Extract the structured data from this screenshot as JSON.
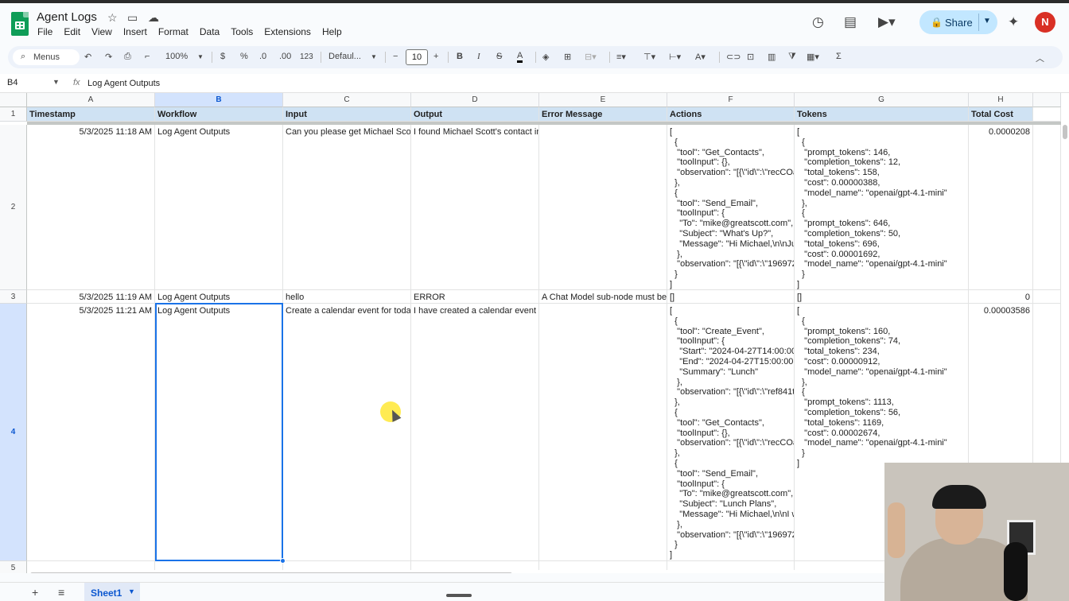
{
  "app": {
    "doc_title": "Agent Logs",
    "menu": [
      "File",
      "Edit",
      "View",
      "Insert",
      "Format",
      "Data",
      "Tools",
      "Extensions",
      "Help"
    ],
    "share_label": "Share",
    "avatar_initial": "N",
    "colors": {
      "accent": "#1a73e8",
      "share_bg": "#c2e7ff",
      "header_fill": "#cfe2f3",
      "avatar": "#d93025",
      "sheets_green": "#0f9d58"
    }
  },
  "toolbar": {
    "menus_label": "Menus",
    "zoom": "100%",
    "currency": "$",
    "percent": "%",
    "dec_decrease": ".0",
    "dec_increase": ".00",
    "number_format": "123",
    "font": "Defaul...",
    "font_size": "10",
    "bold": "B",
    "italic": "I"
  },
  "formula_bar": {
    "cell_ref": "B4",
    "fx": "fx",
    "value": "Log Agent Outputs"
  },
  "grid": {
    "columns": [
      "A",
      "B",
      "C",
      "D",
      "E",
      "F",
      "G",
      "H"
    ],
    "rows": [
      "1",
      "2",
      "3",
      "4",
      "5"
    ],
    "selected_cell": "B4",
    "headers": [
      "Timestamp",
      "Workflow",
      "Input",
      "Output",
      "Error Message",
      "Actions",
      "Tokens",
      "Total Cost"
    ],
    "row2": {
      "timestamp": "5/3/2025 11:18 AM",
      "workflow": "Log Agent Outputs",
      "input": "Can you please get Michael Scott",
      "output": "I found Michael Scott's contact inf",
      "error": "",
      "actions": "[\n  {\n   \"tool\": \"Get_Contacts\",\n   \"toolInput\": {},\n   \"observation\": \"[{\\\"id\\\":\\\"recCOa\n  },\n  {\n   \"tool\": \"Send_Email\",\n   \"toolInput\": {\n    \"To\": \"mike@greatscott.com\",\n    \"Subject\": \"What's Up?\",\n    \"Message\": \"Hi Michael,\\n\\nJu\n   },\n   \"observation\": \"[{\\\"id\\\":\\\"196972\n  }\n]",
      "tokens": "[\n  {\n   \"prompt_tokens\": 146,\n   \"completion_tokens\": 12,\n   \"total_tokens\": 158,\n   \"cost\": 0.00000388,\n   \"model_name\": \"openai/gpt-4.1-mini\"\n  },\n  {\n   \"prompt_tokens\": 646,\n   \"completion_tokens\": 50,\n   \"total_tokens\": 696,\n   \"cost\": 0.00001692,\n   \"model_name\": \"openai/gpt-4.1-mini\"\n  }\n]",
      "total_cost": "0.0000208"
    },
    "row3": {
      "timestamp": "5/3/2025 11:19 AM",
      "workflow": "Log Agent Outputs",
      "input": "hello",
      "output": "ERROR",
      "error": "A Chat Model sub-node must be c",
      "actions": "[]",
      "tokens": "[]",
      "total_cost": "0"
    },
    "row4": {
      "timestamp": "5/3/2025 11:21 AM",
      "workflow": "Log Agent Outputs",
      "input": "Create a calendar event for today",
      "output": "I have created a calendar event fo",
      "error": "",
      "actions": "[\n  {\n   \"tool\": \"Create_Event\",\n   \"toolInput\": {\n    \"Start\": \"2024-04-27T14:00:00\n    \"End\": \"2024-04-27T15:00:00\n    \"Summary\": \"Lunch\"\n   },\n   \"observation\": \"[{\\\"id\\\":\\\"ref841t\n  },\n  {\n   \"tool\": \"Get_Contacts\",\n   \"toolInput\": {},\n   \"observation\": \"[{\\\"id\\\":\\\"recCOa\n  },\n  {\n   \"tool\": \"Send_Email\",\n   \"toolInput\": {\n    \"To\": \"mike@greatscott.com\",\n    \"Subject\": \"Lunch Plans\",\n    \"Message\": \"Hi Michael,\\n\\nI w\n   },\n   \"observation\": \"[{\\\"id\\\":\\\"196972\n  }\n]",
      "tokens": "[\n  {\n   \"prompt_tokens\": 160,\n   \"completion_tokens\": 74,\n   \"total_tokens\": 234,\n   \"cost\": 0.00000912,\n   \"model_name\": \"openai/gpt-4.1-mini\"\n  },\n  {\n   \"prompt_tokens\": 1113,\n   \"completion_tokens\": 56,\n   \"total_tokens\": 1169,\n   \"cost\": 0.00002674,\n   \"model_name\": \"openai/gpt-4.1-mini\"\n  }\n]",
      "total_cost": "0.00003586"
    }
  },
  "sheets": {
    "tabs": [
      "Sheet1"
    ]
  },
  "icons": [
    "sheets-logo-icon",
    "star-icon",
    "move-folder-icon",
    "cloud-status-icon",
    "history-icon",
    "comment-icon",
    "meet-icon",
    "lock-icon",
    "gemini-icon",
    "search-icon",
    "undo-icon",
    "redo-icon",
    "print-icon",
    "paint-format-icon",
    "text-color-icon",
    "fill-color-icon",
    "borders-icon",
    "merge-icon",
    "align-icon",
    "valign-icon",
    "wrap-icon",
    "rotate-icon",
    "link-icon",
    "add-comment-icon",
    "chart-icon",
    "filter-icon",
    "filter-views-icon",
    "functions-icon",
    "collapse-icon",
    "add-sheet-icon",
    "all-sheets-icon"
  ]
}
